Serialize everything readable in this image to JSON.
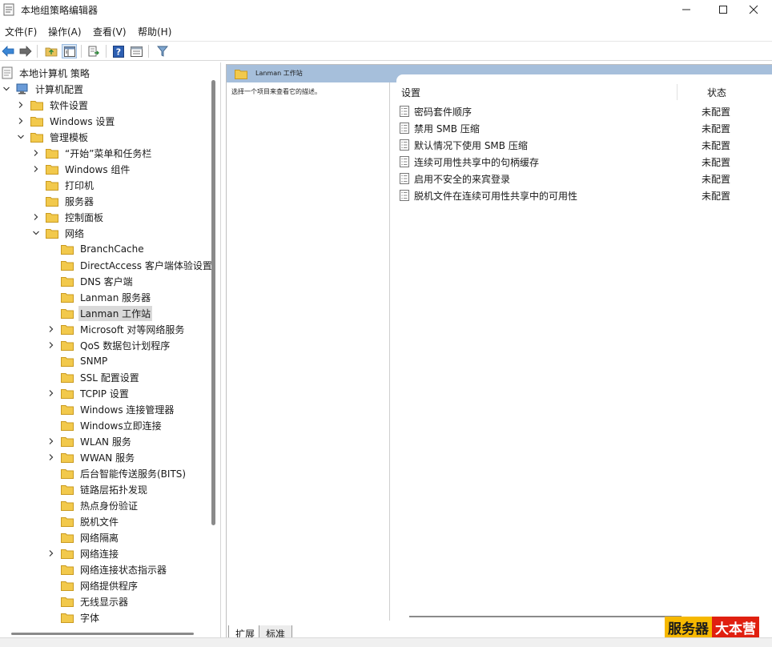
{
  "window": {
    "title": "本地组策略编辑器",
    "controls": {
      "minimize_icon": "minimize-icon",
      "maximize_icon": "maximize-icon",
      "close_icon": "close-icon"
    }
  },
  "menu": [
    "文件(F)",
    "操作(A)",
    "查看(V)",
    "帮助(H)"
  ],
  "toolbar": [
    "back-arrow-icon",
    "forward-arrow-icon",
    "up-folder-icon",
    "show-hide-tree-icon",
    "export-list-icon",
    "help-icon",
    "properties-view-icon",
    "filter-icon"
  ],
  "tree": {
    "root": "本地计算机 策略",
    "computer_config": "计算机配置",
    "software_settings": "软件设置",
    "windows_settings": "Windows 设置",
    "admin_templates": "管理模板",
    "start_menu": "“开始”菜单和任务栏",
    "windows_components": "Windows 组件",
    "printers": "打印机",
    "servers": "服务器",
    "control_panel": "控制面板",
    "network": "网络",
    "network_children": [
      {
        "label": "BranchCache",
        "expandable": false
      },
      {
        "label": "DirectAccess 客户端体验设置",
        "expandable": false
      },
      {
        "label": "DNS 客户端",
        "expandable": false
      },
      {
        "label": "Lanman 服务器",
        "expandable": false
      },
      {
        "label": "Lanman 工作站",
        "expandable": false,
        "selected": true
      },
      {
        "label": "Microsoft 对等网络服务",
        "expandable": true
      },
      {
        "label": "QoS 数据包计划程序",
        "expandable": true
      },
      {
        "label": "SNMP",
        "expandable": false
      },
      {
        "label": "SSL 配置设置",
        "expandable": false
      },
      {
        "label": "TCPIP 设置",
        "expandable": true
      },
      {
        "label": "Windows 连接管理器",
        "expandable": false
      },
      {
        "label": "Windows立即连接",
        "expandable": false
      },
      {
        "label": "WLAN 服务",
        "expandable": true
      },
      {
        "label": "WWAN 服务",
        "expandable": true
      },
      {
        "label": "后台智能传送服务(BITS)",
        "expandable": false
      },
      {
        "label": "链路层拓扑发现",
        "expandable": false
      },
      {
        "label": "热点身份验证",
        "expandable": false
      },
      {
        "label": "脱机文件",
        "expandable": false
      },
      {
        "label": "网络隔离",
        "expandable": false
      },
      {
        "label": "网络连接",
        "expandable": true
      },
      {
        "label": "网络连接状态指示器",
        "expandable": false
      },
      {
        "label": "网络提供程序",
        "expandable": false
      },
      {
        "label": "无线显示器",
        "expandable": false
      },
      {
        "label": "字体",
        "expandable": false
      }
    ]
  },
  "right": {
    "header_title": "Lanman 工作站",
    "description": "选择一个项目来查看它的描述。",
    "columns": {
      "setting": "设置",
      "state": "状态"
    },
    "rows": [
      {
        "name": "密码套件顺序",
        "state": "未配置"
      },
      {
        "name": "禁用 SMB 压缩",
        "state": "未配置"
      },
      {
        "name": "默认情况下使用 SMB 压缩",
        "state": "未配置"
      },
      {
        "name": "连续可用性共享中的句柄缓存",
        "state": "未配置"
      },
      {
        "name": "启用不安全的来宾登录",
        "state": "未配置"
      },
      {
        "name": "脱机文件在连续可用性共享中的可用性",
        "state": "未配置"
      }
    ]
  },
  "tabs": [
    "扩展",
    "标准"
  ],
  "watermark": {
    "left": "服务器",
    "right": "大本营"
  },
  "colors": {
    "header_blue": "#a6bfdb",
    "folder_yellow": "#f2c94c",
    "selection_gray": "#d9d9d9"
  }
}
